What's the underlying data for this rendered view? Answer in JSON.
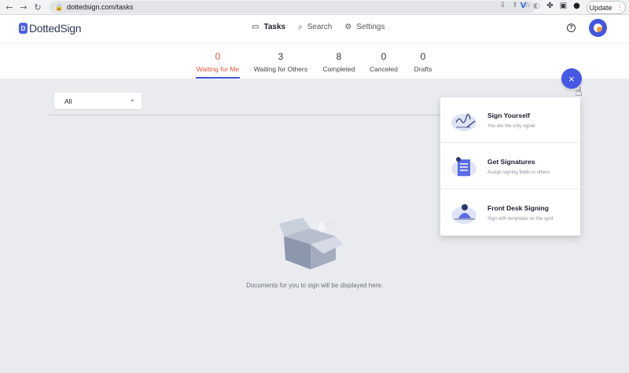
{
  "browser": {
    "url": "dottedsign.com/tasks",
    "update_label": "Update",
    "nav_icons": [
      "back-icon",
      "forward-icon",
      "reload-icon"
    ]
  },
  "app": {
    "logo_text": "DottedSign",
    "logo_mark": "D",
    "nav": [
      {
        "label": "Tasks",
        "icon": "inbox-icon",
        "active": true
      },
      {
        "label": "Search",
        "icon": "search-icon",
        "active": false
      },
      {
        "label": "Settings",
        "icon": "gear-icon",
        "active": false
      }
    ],
    "help_glyph": "?"
  },
  "tabs": [
    {
      "count": "0",
      "label": "Waiting for Me",
      "active": true
    },
    {
      "count": "3",
      "label": "Waiting for Others",
      "active": false
    },
    {
      "count": "8",
      "label": "Completed",
      "active": false
    },
    {
      "count": "0",
      "label": "Canceled",
      "active": false
    },
    {
      "count": "0",
      "label": "Drafts",
      "active": false
    }
  ],
  "filter": {
    "value": "All"
  },
  "empty_state": {
    "message": "Documents for you to sign will be displayed here."
  },
  "fab": {
    "glyph": "×"
  },
  "menu": {
    "items": [
      {
        "title": "Sign Yourself",
        "desc": "You are the only signer",
        "icon": "signature-illustration"
      },
      {
        "title": "Get Signatures",
        "desc": "Assign signing fields to others",
        "icon": "document-illustration"
      },
      {
        "title": "Front Desk Signing",
        "desc": "Sign with templates on the spot",
        "icon": "desk-signer-illustration"
      }
    ]
  },
  "colors": {
    "accent": "#4658e3",
    "active_tab": "#e0553b",
    "page_bg": "#e9ebef"
  }
}
